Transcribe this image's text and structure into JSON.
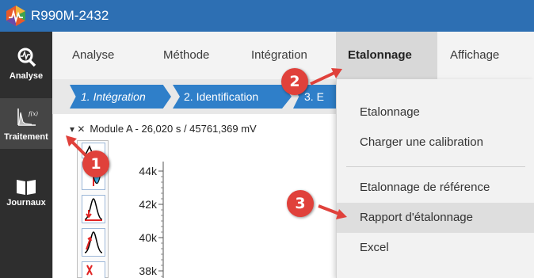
{
  "window": {
    "title": "R990M-2432",
    "logo_icon": "app-logo-icon"
  },
  "sidebar": {
    "items": [
      {
        "label": "Analyse",
        "icon": "analysis-icon"
      },
      {
        "label": "Traitement",
        "icon": "processing-icon"
      },
      {
        "label": "Journaux",
        "icon": "book-icon"
      }
    ],
    "selected": "Traitement"
  },
  "menu": {
    "items": [
      {
        "label": "Analyse"
      },
      {
        "label": "Méthode"
      },
      {
        "label": "Intégration"
      },
      {
        "label": "Etalonnage"
      },
      {
        "label": "Affichage"
      }
    ],
    "active": "Etalonnage"
  },
  "steps": [
    {
      "label": "1. Intégration"
    },
    {
      "label": "2. Identification"
    },
    {
      "label": "3. E"
    }
  ],
  "panel": {
    "controls": "▾ ✕",
    "header": "Module A - 26,020 s / 45761,369 mV"
  },
  "tools": [
    {
      "icon": "peak-add-icon"
    },
    {
      "icon": "baseline-icon"
    },
    {
      "icon": "peak-split-icon"
    },
    {
      "icon": "peak-shift-icon"
    },
    {
      "icon": "peak-delete-icon"
    }
  ],
  "chart_data": {
    "type": "line",
    "y_tick_labels": [
      "44k",
      "42k",
      "40k",
      "38k"
    ],
    "x": [],
    "series": []
  },
  "dropdown": {
    "items": [
      {
        "label": "Etalonnage"
      },
      {
        "label": "Charger une calibration"
      },
      {
        "label": "Etalonnage de référence"
      },
      {
        "label": "Rapport d'étalonnage"
      },
      {
        "label": "Excel"
      }
    ],
    "highlighted": "Rapport d'étalonnage"
  },
  "callouts": [
    "1",
    "2",
    "3"
  ],
  "colors": {
    "titlebar": "#2d6fb3",
    "sidebar": "#2e2e2e",
    "step": "#2f7fc9",
    "callout": "#e0413b"
  }
}
